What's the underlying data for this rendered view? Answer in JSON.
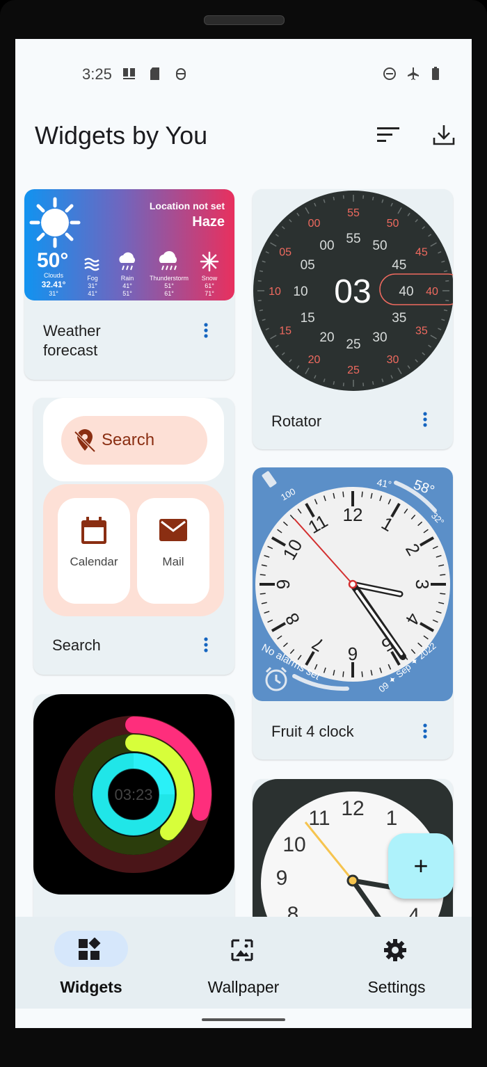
{
  "status_bar": {
    "time": "3:25"
  },
  "app_bar": {
    "title": "Widgets by You"
  },
  "widgets": {
    "weather": {
      "label": "Weather forecast",
      "location": "Location not set",
      "condition": "Haze",
      "current_temp": "50°",
      "current_condition": "Clouds",
      "current_range": "32.41°",
      "current_low": "31°",
      "forecast": [
        {
          "name": "Fog",
          "hi": "31°",
          "lo": "41°"
        },
        {
          "name": "Rain",
          "hi": "41°",
          "lo": "51°"
        },
        {
          "name": "Thunderstorm",
          "hi": "51°",
          "lo": "61°"
        },
        {
          "name": "Snow",
          "hi": "61°",
          "lo": "71°"
        }
      ]
    },
    "rotator": {
      "label": "Rotator",
      "hour": "03",
      "outer_ticks": [
        "55",
        "50",
        "45",
        "40",
        "35",
        "30",
        "25",
        "20",
        "15",
        "10",
        "05",
        "00"
      ],
      "inner_ticks": [
        "40",
        "35",
        "30",
        "25",
        "20",
        "15",
        "10",
        "05",
        "00",
        "55",
        "50",
        "45"
      ]
    },
    "search": {
      "label": "Search",
      "search_text": "Search",
      "apps": [
        "Calendar",
        "Mail"
      ]
    },
    "fruit_clock": {
      "label": "Fruit 4 clock",
      "battery": "100",
      "temp_low": "41°",
      "temp_now": "58°",
      "temp_high": "32°",
      "alarm_text": "No alarms set",
      "date": "09 ✦ Sep ✦ 2022",
      "numerals": [
        "12",
        "1",
        "2",
        "3",
        "4",
        "5",
        "6",
        "7",
        "8",
        "9",
        "10",
        "11"
      ]
    },
    "activity": {
      "time": "03:23"
    },
    "analog": {
      "numerals": [
        "12",
        "1",
        "10",
        "11",
        "9",
        "8",
        "4"
      ]
    }
  },
  "fab": {
    "label": "+"
  },
  "bottom_nav": {
    "items": [
      "Widgets",
      "Wallpaper",
      "Settings"
    ],
    "selected": "Widgets"
  },
  "colors": {
    "accent": "#1565c0",
    "fab": "#aef2fb",
    "nav_pill": "#d6e7fb"
  }
}
